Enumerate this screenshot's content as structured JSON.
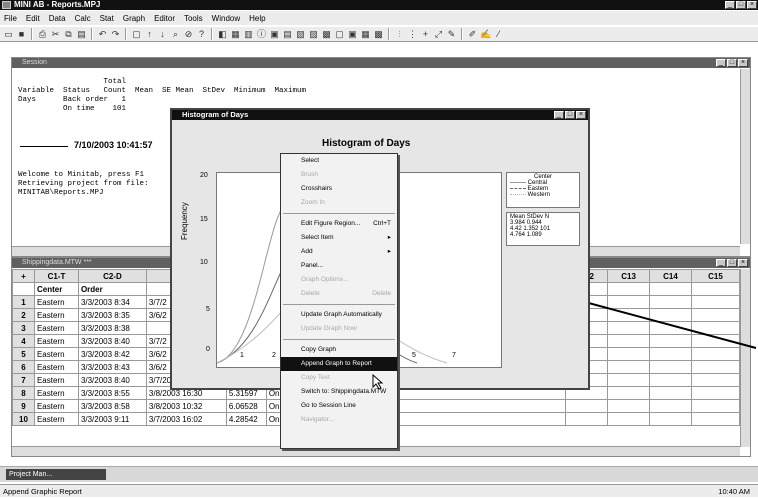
{
  "app": {
    "title": "MINI AB - Reports.MPJ",
    "window_buttons": [
      "_",
      "□",
      "×"
    ]
  },
  "menu": [
    "File",
    "Edit",
    "Data",
    "Calc",
    "Stat",
    "Graph",
    "Editor",
    "Tools",
    "Window",
    "Help"
  ],
  "session": {
    "title": "Session",
    "table_header1": "                   Total",
    "table_header2": "Variable  Status   Count  Mean  SE Mean  StDev  Minimum  Maximum",
    "row1": "Days      Back order   1",
    "row2": "          On time    101",
    "datetime": "7/10/2003 10:41:57",
    "welcome1": "Welcome to Minitab, press F1",
    "welcome2": "Retrieving project from file:",
    "welcome3": "MINITAB\\Reports.MPJ"
  },
  "worksheet": {
    "title": "Shippingdata.MTW ***",
    "col_ids": [
      "+",
      "C1-T",
      "C2-D",
      "C12",
      "C13",
      "C14",
      "C15"
    ],
    "col_names": [
      "",
      "Center",
      "Order"
    ],
    "rows": [
      [
        "1",
        "Eastern",
        "3/3/2003 8:34",
        "3/7/2"
      ],
      [
        "2",
        "Eastern",
        "3/3/2003 8:35",
        "3/6/2"
      ],
      [
        "3",
        "Eastern",
        "3/3/2003 8:38",
        ""
      ],
      [
        "4",
        "Eastern",
        "3/3/2003 8:40",
        "3/7/2"
      ],
      [
        "5",
        "Eastern",
        "3/3/2003 8:42",
        "3/6/2"
      ],
      [
        "6",
        "Eastern",
        "3/3/2003 8:43",
        "3/6/2"
      ],
      [
        "7",
        "Eastern",
        "3/3/2003 8:40",
        "3/7/2003 10:02",
        "4.05000",
        "On t"
      ],
      [
        "8",
        "Eastern",
        "3/3/2003 8:55",
        "3/8/2003 16:30",
        "5.31597",
        "On t"
      ],
      [
        "9",
        "Eastern",
        "3/3/2003 8:58",
        "3/8/2003 10:32",
        "6.06528",
        "On t"
      ],
      [
        "10",
        "Eastern",
        "3/3/2003 9:11",
        "3/7/2003 16:02",
        "4.28542",
        "On t"
      ]
    ]
  },
  "histogram": {
    "title": "Histogram of Days",
    "chart_title": "Histogram of Days",
    "ylabel": "Frequency",
    "yticks": [
      "20",
      "15",
      "10",
      "5",
      "0"
    ],
    "xticks": [
      "1",
      "2",
      "5",
      "7"
    ],
    "legend": {
      "title": "Center",
      "items": [
        "Central",
        "Eastern",
        "Western"
      ]
    },
    "stats": {
      "header": [
        "Mean",
        "StDev",
        "N"
      ],
      "rows": [
        [
          "3.984",
          "0.944",
          "?"
        ],
        [
          "4.42",
          "1.352",
          "101"
        ],
        [
          "4.764",
          "1.089",
          "?"
        ]
      ]
    }
  },
  "context_menu": [
    {
      "label": "Select",
      "disabled": false
    },
    {
      "label": "Brush",
      "disabled": true
    },
    {
      "label": "Crosshairs",
      "disabled": false
    },
    {
      "label": "Zoom In",
      "disabled": true
    },
    {
      "sep": true
    },
    {
      "label": "Edit Figure Region...",
      "shortcut": "Ctrl+T",
      "disabled": false
    },
    {
      "label": "Select Item",
      "sub": true,
      "disabled": false
    },
    {
      "label": "Add",
      "sub": true,
      "disabled": false
    },
    {
      "label": "Panel...",
      "disabled": false
    },
    {
      "label": "Graph Options...",
      "disabled": true
    },
    {
      "label": "Delete",
      "shortcut": "Delete",
      "disabled": true
    },
    {
      "sep": true
    },
    {
      "label": "Update Graph Automatically",
      "disabled": false
    },
    {
      "label": "Update Graph Now",
      "disabled": true
    },
    {
      "sep": true
    },
    {
      "label": "Copy Graph",
      "disabled": false
    },
    {
      "label": "Append Graph to Report",
      "highlight": true,
      "disabled": false
    },
    {
      "label": "Copy Text",
      "disabled": true
    },
    {
      "label": "Switch to: Shippingdata.MTW",
      "disabled": false
    },
    {
      "label": "Go to Session Line",
      "disabled": false
    },
    {
      "label": "Navigator...",
      "disabled": true
    }
  ],
  "taskbar": {
    "item": "Project Man..."
  },
  "status": {
    "text": "Append Graphic Report",
    "time": "10:40 AM"
  }
}
